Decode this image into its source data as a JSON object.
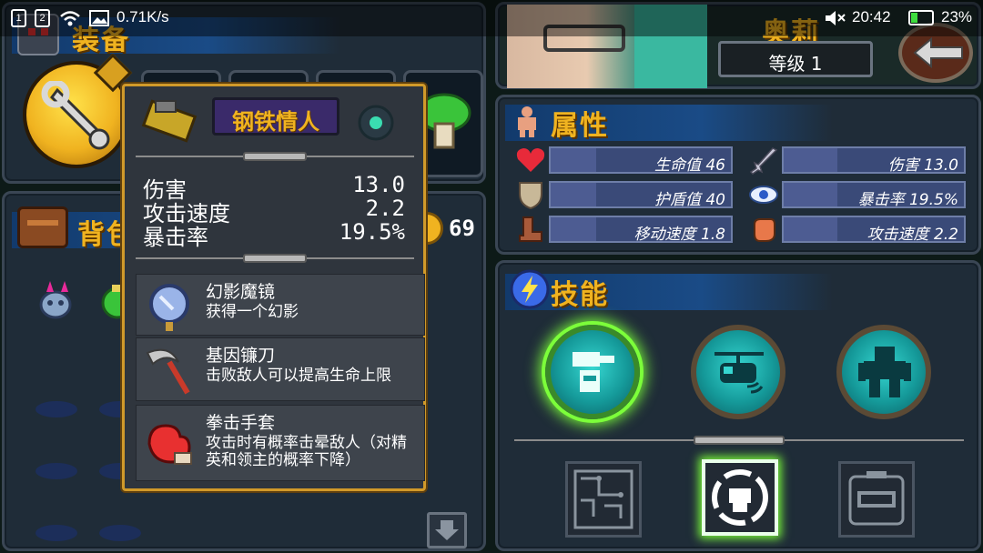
{
  "statusbar": {
    "sim1": "1",
    "sim2": "2",
    "speed": "0.71K/s",
    "time": "20:42",
    "battery": "23%"
  },
  "equipment": {
    "title": "装备"
  },
  "backpack": {
    "title": "背包",
    "coins": "69"
  },
  "tooltip": {
    "name": "钢铁情人",
    "stats": [
      {
        "label": "伤害",
        "value": "13.0"
      },
      {
        "label": "攻击速度",
        "value": "2.2"
      },
      {
        "label": "暴击率",
        "value": "19.5%"
      }
    ],
    "effects": [
      {
        "name": "幻影魔镜",
        "desc": "获得一个幻影"
      },
      {
        "name": "基因镰刀",
        "desc": "击败敌人可以提高生命上限"
      },
      {
        "name": "拳击手套",
        "desc": "攻击时有概率击晕敌人（对精英和领主的概率下降）"
      }
    ]
  },
  "character": {
    "name": "奥莉",
    "level": "等级 1"
  },
  "attributes": {
    "title": "属性",
    "items": [
      {
        "label": "生命值 46",
        "icon": "heart-icon",
        "fill": 0.25
      },
      {
        "label": "伤害 13.0",
        "icon": "sword-icon",
        "fill": 0.3
      },
      {
        "label": "护盾值 40",
        "icon": "shield-icon",
        "fill": 0.25
      },
      {
        "label": "暴击率 19.5%",
        "icon": "eye-icon",
        "fill": 0.3
      },
      {
        "label": "移动速度 1.8",
        "icon": "boot-icon",
        "fill": 0.25
      },
      {
        "label": "攻击速度 2.2",
        "icon": "fist-icon",
        "fill": 0.3
      }
    ]
  },
  "skills": {
    "title": "技能"
  },
  "colors": {
    "title": "#f0b320",
    "panel": "#1f2c38",
    "tooltip_border": "#d19a2a",
    "skill_glow": "#7cff3a"
  }
}
